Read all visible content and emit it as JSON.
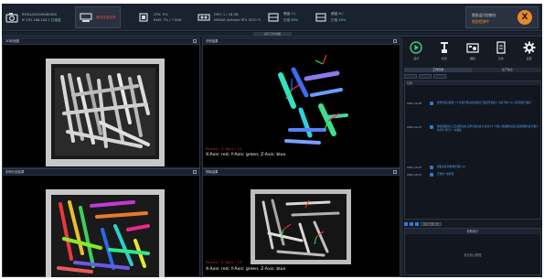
{
  "topbar": {
    "camera": {
      "line1": "RMZ4ACDGHkHK0D0",
      "line2": "IP 192.168.100.2",
      "status": "已连接"
    },
    "alert": {
      "text": "通讯连接异常"
    },
    "cpu": {
      "line1": "CPU: 5%",
      "line2": "RAM: 7% / 7.5GB"
    },
    "gpu": {
      "line1": "GPU: 1 / 16 GB",
      "line2": "NVIDIA GeForce RTX 3070 Ti"
    },
    "disk1": {
      "line1": "硬盘 C:/",
      "line2": "已用 60%"
    },
    "disk2": {
      "line1": "硬盘 D:/",
      "line2": "已用 40%"
    },
    "ai": {
      "line1": "视觉运行控制台",
      "line2": "视觉检测中",
      "logo": "X"
    }
  },
  "subbar": {
    "tab": "运行工作视图"
  },
  "panels": {
    "p1": {
      "title": "2D彩色图"
    },
    "p2": {
      "title": "识别结果",
      "overlay1": "Points: 3  Objs: 13",
      "overlay2": "X-Axis: red; Y-Axis: green; Z-Axis: blue"
    },
    "p3": {
      "title": "实例分割结果"
    },
    "p4": {
      "title": "抓取结果",
      "overlay1": "Points: 3  Objs: 13",
      "overlay2": "X-Axis: red; Y-Axis: green; Z-Axis: blue"
    }
  },
  "tools": [
    {
      "label": "运行",
      "icon": "play-icon"
    },
    {
      "label": "标定",
      "icon": "calibrate-icon"
    },
    {
      "label": "相机",
      "icon": "camera-icon"
    },
    {
      "label": "日志",
      "icon": "file-icon"
    },
    {
      "label": "设置",
      "icon": "gear-icon"
    }
  ],
  "rtabs": [
    "工作日志",
    "生产信息"
  ],
  "log": {
    "header": "日志",
    "rows": [
      {
        "time": "2021-10-26",
        "msg": "检测到目标数量: 13  位姿计算完成  抓取点已发送至机器人  当前节拍 1.2s  识别结果已保存"
      },
      {
        "time": "2021-10-27",
        "msg": "相机采集成功  点云处理完成  实例分割完成  共识别 13 个目标  抓取规划完成  发送抓取位姿  机器人执行中  等待下一帧采集"
      },
      {
        "time": "2021-10-27",
        "msg": "抓取完成  料框剩余目标 12"
      },
      {
        "time": "2021-10-27",
        "msg": "开始新一轮检测"
      }
    ]
  },
  "logfoot": {
    "filter": "显示 全部 日志"
  },
  "stats": {
    "title": "抓取统计",
    "empty": "暂无统计数据"
  }
}
